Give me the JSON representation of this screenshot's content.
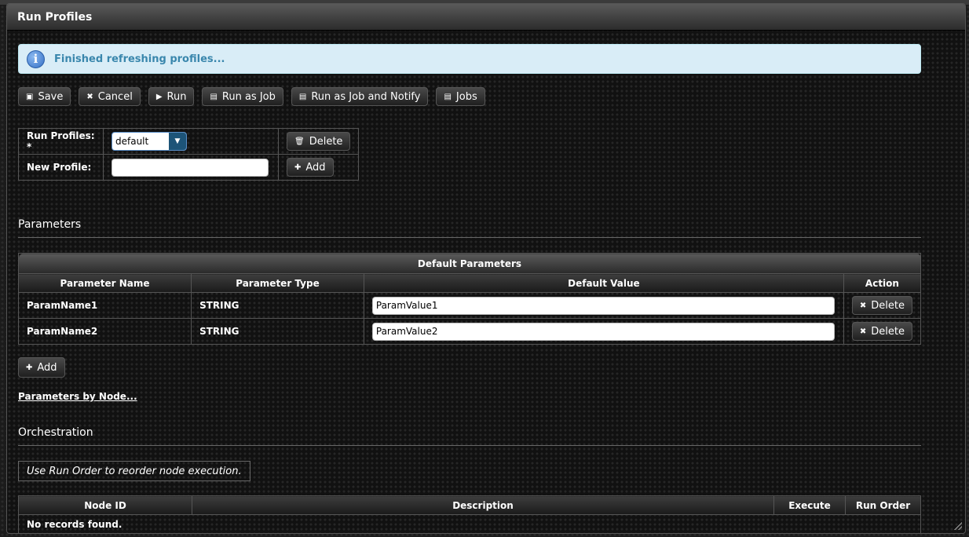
{
  "dialog": {
    "title": "Run Profiles"
  },
  "message": {
    "text": "Finished refreshing profiles..."
  },
  "toolbar": {
    "save": "Save",
    "cancel": "Cancel",
    "run": "Run",
    "run_as_job": "Run as Job",
    "run_as_job_notify": "Run as Job and Notify",
    "jobs": "Jobs"
  },
  "profiles": {
    "run_profiles_label": "Run Profiles: *",
    "selected_profile": "default",
    "delete": "Delete",
    "new_profile_label": "New Profile:",
    "new_profile_value": "",
    "add": "Add"
  },
  "parameters": {
    "section_title": "Parameters",
    "table_caption": "Default Parameters",
    "columns": [
      "Parameter Name",
      "Parameter Type",
      "Default Value",
      "Action"
    ],
    "rows": [
      {
        "name": "ParamName1",
        "type": "STRING",
        "value": "ParamValue1",
        "action": "Delete"
      },
      {
        "name": "ParamName2",
        "type": "STRING",
        "value": "ParamValue2",
        "action": "Delete"
      }
    ],
    "add": "Add",
    "by_node_link": "Parameters by Node..."
  },
  "orchestration": {
    "section_title": "Orchestration",
    "hint": "Use Run Order to reorder node execution.",
    "columns": [
      "Node ID",
      "Description",
      "Execute",
      "Run Order"
    ],
    "empty_text": "No records found."
  },
  "icons": {
    "info": "info-icon",
    "save": "floppy-icon",
    "cancel": "x-icon",
    "run": "play-icon",
    "job": "list-icon",
    "delete": "trash-icon",
    "add": "plus-icon",
    "dropdown": "triangle-down-icon"
  }
}
